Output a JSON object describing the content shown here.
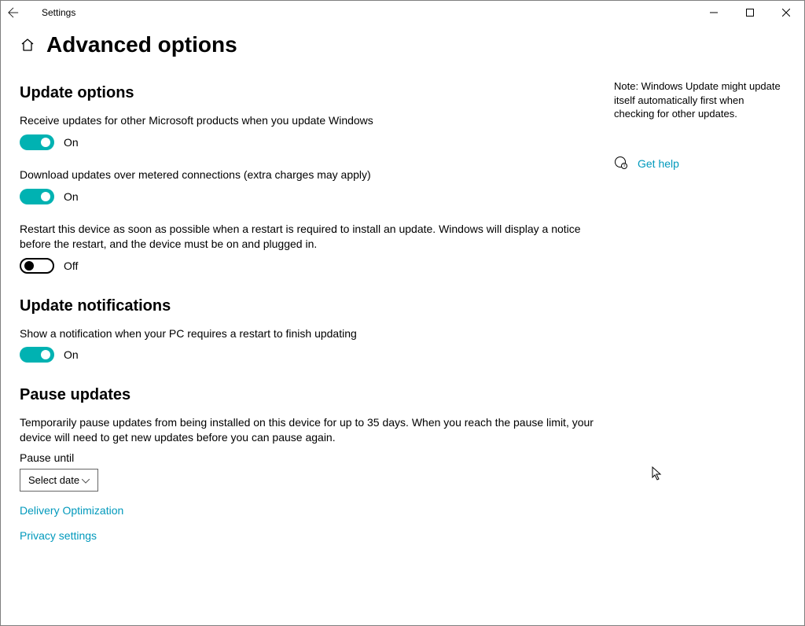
{
  "titlebar": {
    "title": "Settings"
  },
  "page": {
    "heading": "Advanced options"
  },
  "sections": {
    "update_options": {
      "heading": "Update options",
      "opt1": {
        "desc": "Receive updates for other Microsoft products when you update Windows",
        "state": "On"
      },
      "opt2": {
        "desc": "Download updates over metered connections (extra charges may apply)",
        "state": "On"
      },
      "opt3": {
        "desc": "Restart this device as soon as possible when a restart is required to install an update. Windows will display a notice before the restart, and the device must be on and plugged in.",
        "state": "Off"
      }
    },
    "notifications": {
      "heading": "Update notifications",
      "opt1": {
        "desc": "Show a notification when your PC requires a restart to finish updating",
        "state": "On"
      }
    },
    "pause": {
      "heading": "Pause updates",
      "desc": "Temporarily pause updates from being installed on this device for up to 35 days. When you reach the pause limit, your device will need to get new updates before you can pause again.",
      "label": "Pause until",
      "dropdown": "Select date"
    }
  },
  "links": {
    "delivery": "Delivery Optimization",
    "privacy": "Privacy settings"
  },
  "side": {
    "note": "Note: Windows Update might update itself automatically first when checking for other updates.",
    "help": "Get help"
  }
}
